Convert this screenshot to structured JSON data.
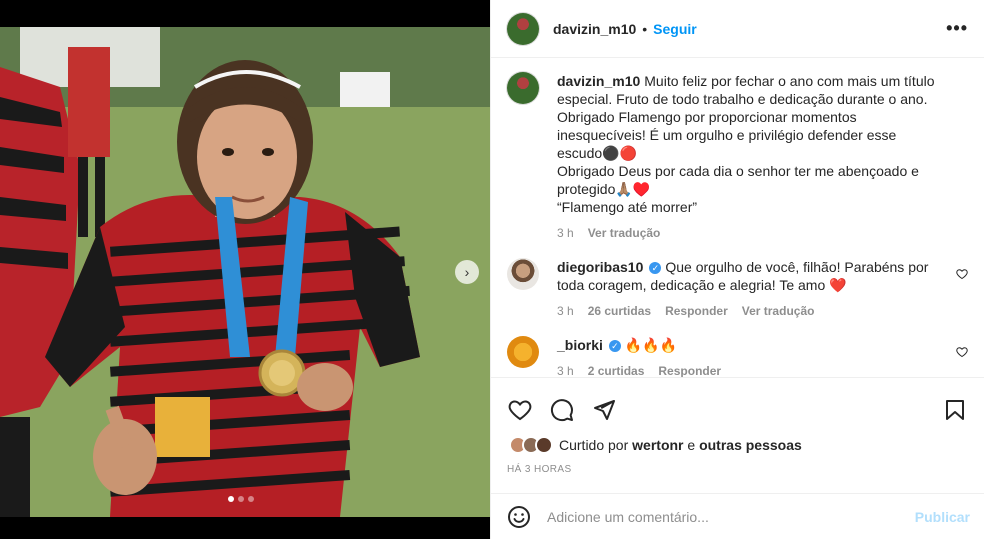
{
  "post": {
    "username": "davizin_m10",
    "follow_label": "Seguir",
    "separator": "•",
    "more_label": "•••"
  },
  "caption": {
    "username": "davizin_m10",
    "text_lines": [
      "Muito feliz por fechar o ano com mais um título especial. Fruto de todo trabalho e dedicação durante o ano. Obrigado Flamengo por proporcionar momentos inesquecíveis! É um orgulho e privilégio defender esse escudo⚫🔴",
      "Obrigado Deus por cada dia o senhor ter me abençoado e protegido🙏🏽♥️",
      "“Flamengo até morrer”"
    ],
    "time": "3 h",
    "translate": "Ver tradução"
  },
  "comments": [
    {
      "username": "diegoribas10",
      "verified": true,
      "text": "Que orgulho de você, filhão! Parabéns por toda coragem, dedicação e alegria! Te amo ❤️",
      "time": "3 h",
      "likes": "26 curtidas",
      "reply": "Responder",
      "translate": "Ver tradução"
    },
    {
      "username": "_biorki",
      "verified": true,
      "text": "🔥🔥🔥",
      "time": "3 h",
      "likes": "2 curtidas",
      "reply": "Responder"
    }
  ],
  "likes_line": {
    "prefix": "Curtido por",
    "user": "wertonr",
    "connector": "e",
    "others": "outras pessoas"
  },
  "timestamp": "HÁ 3 HORAS",
  "add_comment": {
    "placeholder": "Adicione um comentário...",
    "publish": "Publicar"
  },
  "icons": {
    "like": "heart-icon",
    "comment": "comment-icon",
    "share": "send-icon",
    "save": "bookmark-icon",
    "emoji": "emoji-icon",
    "next": "chevron-right-icon"
  },
  "colors": {
    "accent": "#0095f6",
    "verified": "#3897f0",
    "publish_disabled": "#b2dffc",
    "like_red": "#ed4956"
  },
  "carousel": {
    "total": 3,
    "active": 1
  }
}
